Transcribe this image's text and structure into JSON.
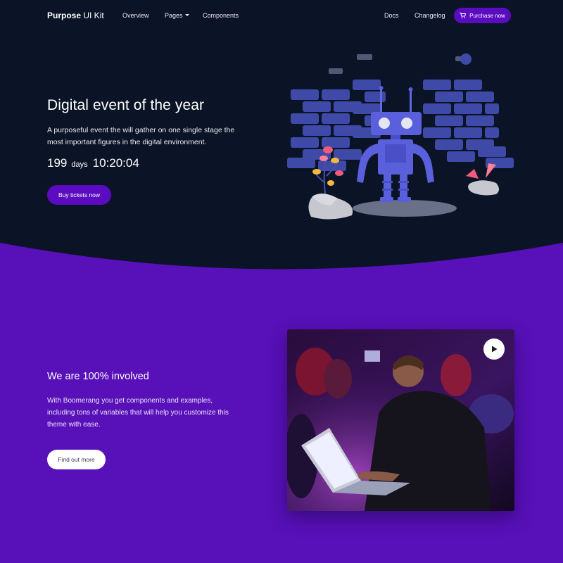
{
  "nav": {
    "brand_bold": "Purpose",
    "brand_rest": " UI Kit",
    "links": [
      "Overview",
      "Pages",
      "Components"
    ],
    "right_links": [
      "Docs",
      "Changelog"
    ],
    "cta": "Purchase now",
    "cta_icon": "cart-icon"
  },
  "hero": {
    "title": "Digital event of the year",
    "lead": "A purposeful event the will gather on one single stage the most important figures in the digital environment.",
    "countdown": {
      "days_value": "199",
      "days_label": "days",
      "time": "10:20:04"
    },
    "button": "Buy tickets now",
    "illustration": "robot-illustration"
  },
  "section": {
    "title": "We are 100% involved",
    "text": "With Boomerang you get components and examples, including tons of variables that will help you customize this theme with ease.",
    "button": "Find out more",
    "media": "event-photo",
    "play_icon": "play-icon"
  },
  "colors": {
    "hero_bg": "#0b1426",
    "section_bg": "#5810b8",
    "accent": "#5b0bc0",
    "illustration_brick": "#3f4aa8",
    "robot": "#5a5fdb"
  }
}
